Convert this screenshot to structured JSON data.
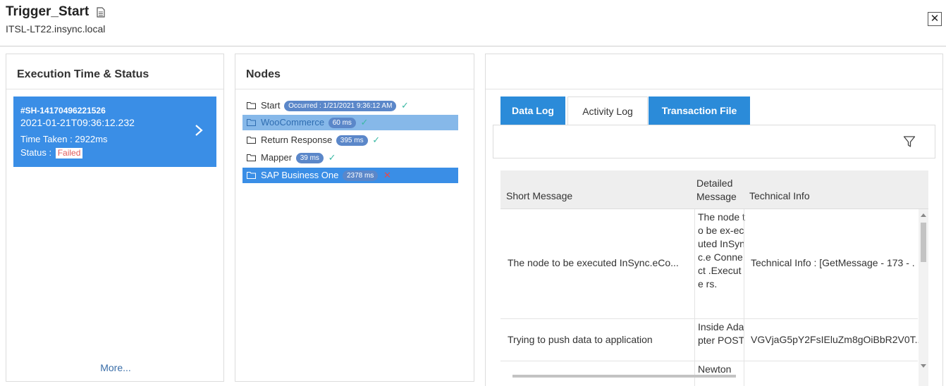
{
  "header": {
    "title": "Trigger_Start",
    "subtitle": "ITSL-LT22.insync.local",
    "close_symbol": "✕"
  },
  "execution": {
    "title": "Execution Time & Status",
    "card": {
      "id": "#SH-14170496221526",
      "timestamp": "2021-01-21T09:36:12.232",
      "time_taken": "Time Taken : 2922ms",
      "status_label": "Status :",
      "status_value": "Failed"
    },
    "more": "More..."
  },
  "nodes": {
    "title": "Nodes",
    "items": [
      {
        "label": "Start",
        "badge": "Occurred : 1/21/2021 9:36:12 AM",
        "result": "✓",
        "state": "normal"
      },
      {
        "label": "WooCommerce",
        "badge": "60 ms",
        "result": "✓",
        "state": "selected-light"
      },
      {
        "label": "Return Response",
        "badge": "395 ms",
        "result": "✓",
        "state": "normal"
      },
      {
        "label": "Mapper",
        "badge": "39 ms",
        "result": "✓",
        "state": "normal"
      },
      {
        "label": "SAP Business One",
        "badge": "2378 ms",
        "result": "✕",
        "state": "selected-dark"
      }
    ]
  },
  "details": {
    "tabs": [
      {
        "label": "Data Log",
        "active": false
      },
      {
        "label": "Activity Log",
        "active": true
      },
      {
        "label": "Transaction File",
        "active": false
      }
    ],
    "grid": {
      "columns": [
        "Short Message",
        "Detailed Message",
        "Technical Info"
      ],
      "rows": [
        {
          "short": "The node to be executed InSync.eCo...",
          "detailed": "The node to be ex-ecuted InSync.e Connect .Execute rs.",
          "technical": "Technical Info : [GetMessage - 173 - ."
        },
        {
          "short": "Trying to push data to application",
          "detailed": "Inside Adapter POST",
          "technical": "VGVjaG5pY2FsIEluZm8gOiBbR2V0T.."
        },
        {
          "short": "",
          "detailed": "Newton",
          "technical": ""
        }
      ]
    }
  },
  "colors": {
    "accent_blue": "#3a8ee6",
    "tab_blue": "#2b8bd9",
    "failed_red": "#e05a5a",
    "success_teal": "#3bb9a4"
  }
}
